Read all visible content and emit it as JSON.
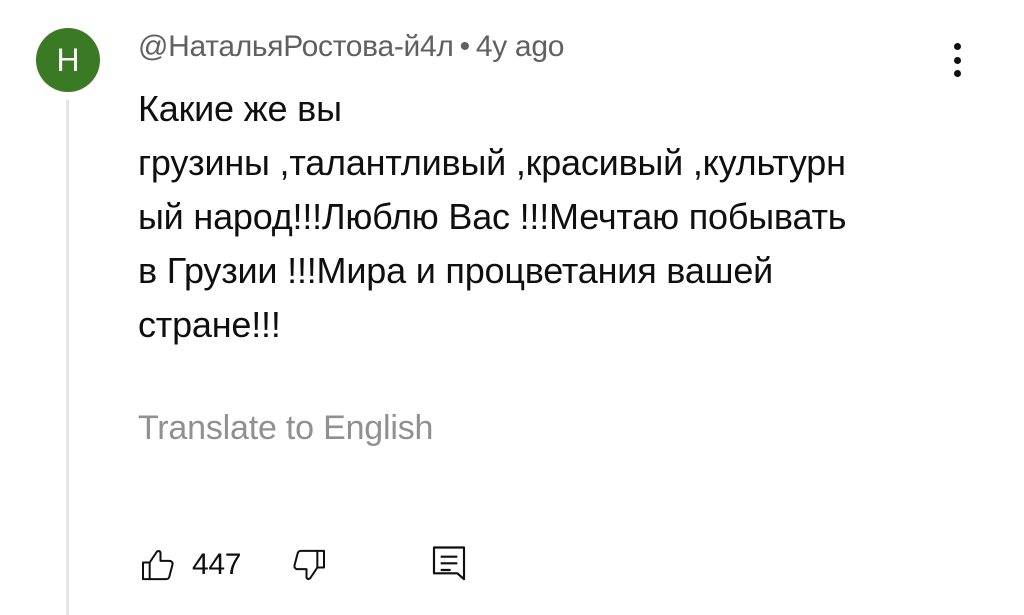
{
  "comment": {
    "avatar_letter": "Н",
    "avatar_color": "#3b7a25",
    "author": "@НатальяРостова-й4л",
    "separator": "•",
    "time": "4y ago",
    "text": "Какие же вы\nгрузины ,талантливый ,красивый ,культурн\nый народ!!!Люблю Вас !!!Мечтаю побывать\nв Грузии !!!Мира и процветания вашей\nстране!!!",
    "translate_label": "Translate to English",
    "like_count": "447"
  },
  "icons": {
    "more": "more-vertical-icon",
    "like": "thumbs-up-icon",
    "dislike": "thumbs-down-icon",
    "reply": "reply-comment-icon"
  }
}
